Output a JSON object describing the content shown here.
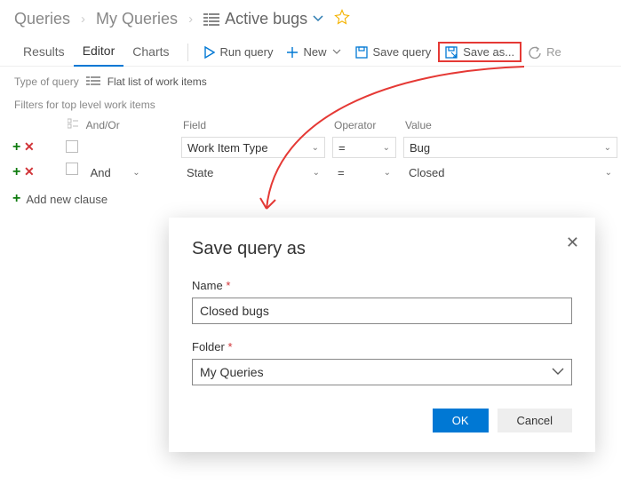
{
  "breadcrumb": {
    "root": "Queries",
    "mid": "My Queries",
    "current": "Active bugs"
  },
  "tabs": {
    "results": "Results",
    "editor": "Editor",
    "charts": "Charts"
  },
  "toolbar": {
    "run": "Run query",
    "new": "New",
    "save": "Save query",
    "saveas": "Save as...",
    "revert_short": "Re"
  },
  "typequery": {
    "label": "Type of query",
    "value": "Flat list of work items"
  },
  "filters": {
    "header": "Filters for top level work items",
    "cols": {
      "andor": "And/Or",
      "field": "Field",
      "operator": "Operator",
      "value": "Value"
    },
    "rows": [
      {
        "andor": "",
        "field": "Work Item Type",
        "operator": "=",
        "value": "Bug"
      },
      {
        "andor": "And",
        "field": "State",
        "operator": "=",
        "value": "Closed"
      }
    ],
    "addclause": "Add new clause"
  },
  "dialog": {
    "title": "Save query as",
    "name_label": "Name",
    "name_value": "Closed bugs",
    "folder_label": "Folder",
    "folder_value": "My Queries",
    "ok": "OK",
    "cancel": "Cancel"
  }
}
